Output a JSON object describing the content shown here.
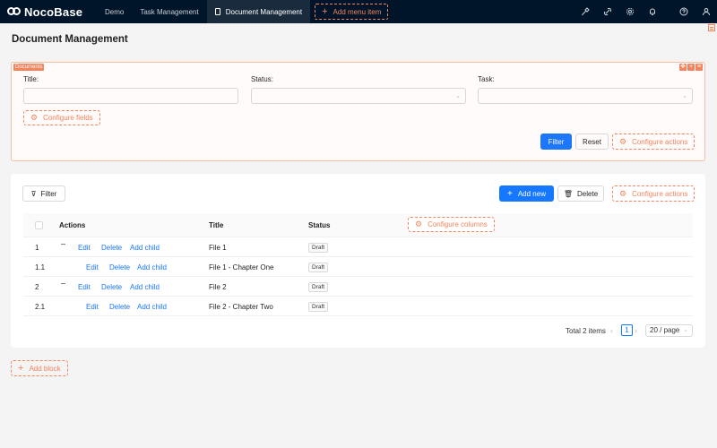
{
  "brand": {
    "name": "NocoBase"
  },
  "nav": {
    "items": [
      {
        "label": "Demo"
      },
      {
        "label": "Task Management"
      },
      {
        "label": "Document Management"
      }
    ],
    "add_menu_label": "Add menu item",
    "right_icons": [
      "design-icon",
      "plugin-icon",
      "settings-icon",
      "bell-icon",
      "help-icon",
      "user-icon"
    ]
  },
  "page": {
    "title": "Document Management"
  },
  "filter_block": {
    "tag": "Documents",
    "fields": [
      {
        "label": "Title",
        "value": "",
        "type": "text"
      },
      {
        "label": "Status",
        "value": "",
        "type": "select"
      },
      {
        "label": "Task",
        "value": "",
        "type": "select"
      }
    ],
    "configure_fields_label": "Configure fields",
    "filter_label": "Filter",
    "reset_label": "Reset",
    "configure_actions_label": "Configure actions"
  },
  "table_block": {
    "filter_label": "Filter",
    "add_new_label": "Add new",
    "delete_label": "Delete",
    "configure_actions_label": "Configure actions",
    "columns": [
      "Actions",
      "Title",
      "Status"
    ],
    "configure_columns_label": "Configure columns",
    "rows": [
      {
        "id": "1",
        "expandable": true,
        "actions": [
          "Edit",
          "Delete",
          "Add child"
        ],
        "title": "File 1",
        "status": "Draft"
      },
      {
        "id": "1.1",
        "expandable": false,
        "actions": [
          "Edit",
          "Delete",
          "Add child"
        ],
        "title": "File 1 - Chapter One",
        "status": "Draft"
      },
      {
        "id": "2",
        "expandable": true,
        "actions": [
          "Edit",
          "Delete",
          "Add child"
        ],
        "title": "File 2",
        "status": "Draft"
      },
      {
        "id": "2.1",
        "expandable": false,
        "actions": [
          "Edit",
          "Delete",
          "Add child"
        ],
        "title": "File 2 - Chapter Two",
        "status": "Draft"
      }
    ],
    "pagination": {
      "total_text": "Total 2 items",
      "current_page": "1",
      "page_size": "20 / page"
    }
  },
  "add_block_label": "Add block",
  "colors": {
    "topbar": "#001529",
    "primary": "#1677ff",
    "design_accent": "#f2855e"
  }
}
